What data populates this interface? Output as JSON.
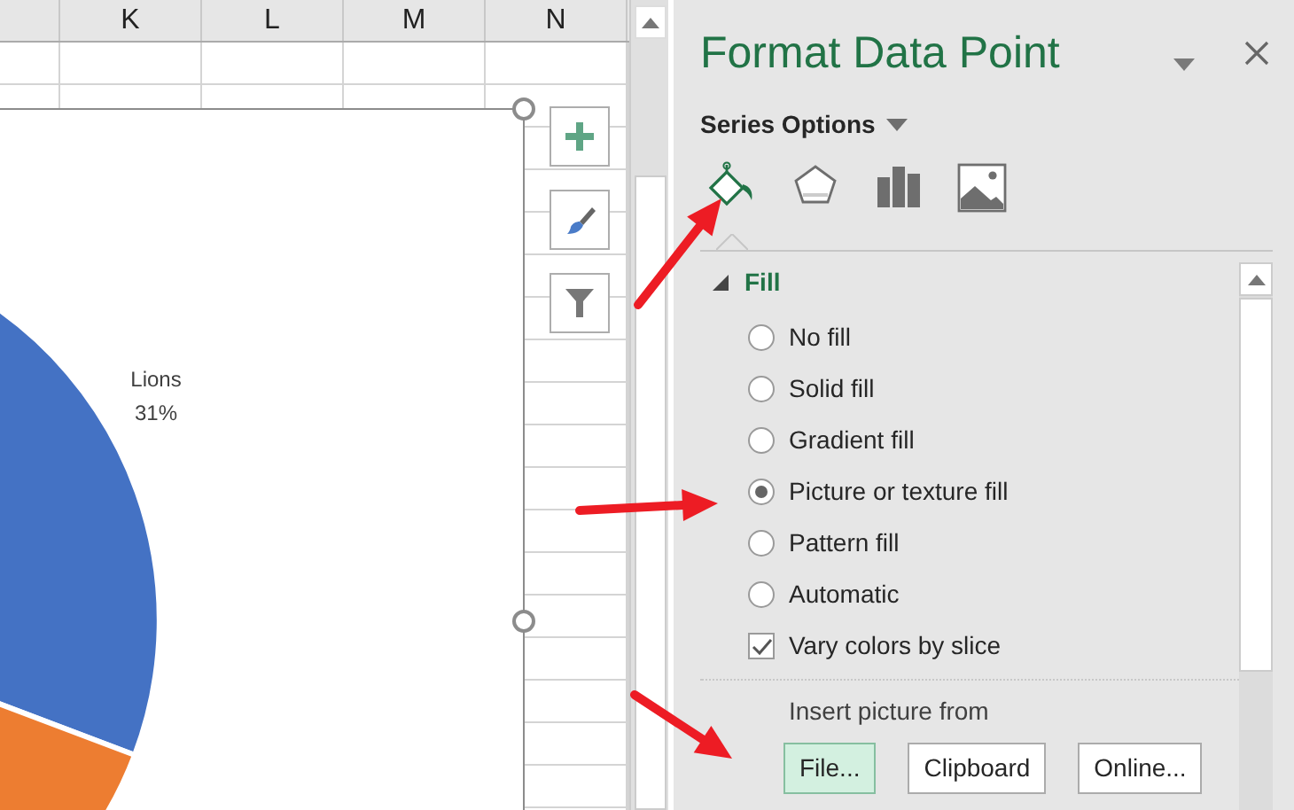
{
  "sheet": {
    "columns": [
      {
        "label": "K"
      },
      {
        "label": "L"
      },
      {
        "label": "M"
      },
      {
        "label": "N"
      }
    ]
  },
  "chart": {
    "data_label": {
      "name": "Lions",
      "percent": "31%"
    },
    "buttons": [
      {
        "kind": "add"
      },
      {
        "kind": "style"
      },
      {
        "kind": "filter"
      }
    ]
  },
  "pane": {
    "title": "Format Data Point",
    "options_menu": "Series Options",
    "tabs": [
      {
        "kind": "fill",
        "selected": true
      },
      {
        "kind": "effects",
        "selected": false
      },
      {
        "kind": "series",
        "selected": false
      },
      {
        "kind": "picture",
        "selected": false
      }
    ],
    "section": {
      "title": "Fill",
      "expanded": true,
      "options": [
        {
          "label": "No fill",
          "selected": false
        },
        {
          "label": "Solid fill",
          "selected": false
        },
        {
          "label": "Gradient fill",
          "selected": false
        },
        {
          "label": "Picture or texture fill",
          "selected": true
        },
        {
          "label": "Pattern fill",
          "selected": false
        },
        {
          "label": "Automatic",
          "selected": false
        }
      ],
      "vary_colors": {
        "label": "Vary colors by slice",
        "checked": true
      },
      "insert_label": "Insert picture from",
      "buttons": [
        {
          "label": "File...",
          "selected": true
        },
        {
          "label": "Clipboard",
          "selected": false
        },
        {
          "label": "Online...",
          "selected": false
        }
      ]
    }
  }
}
